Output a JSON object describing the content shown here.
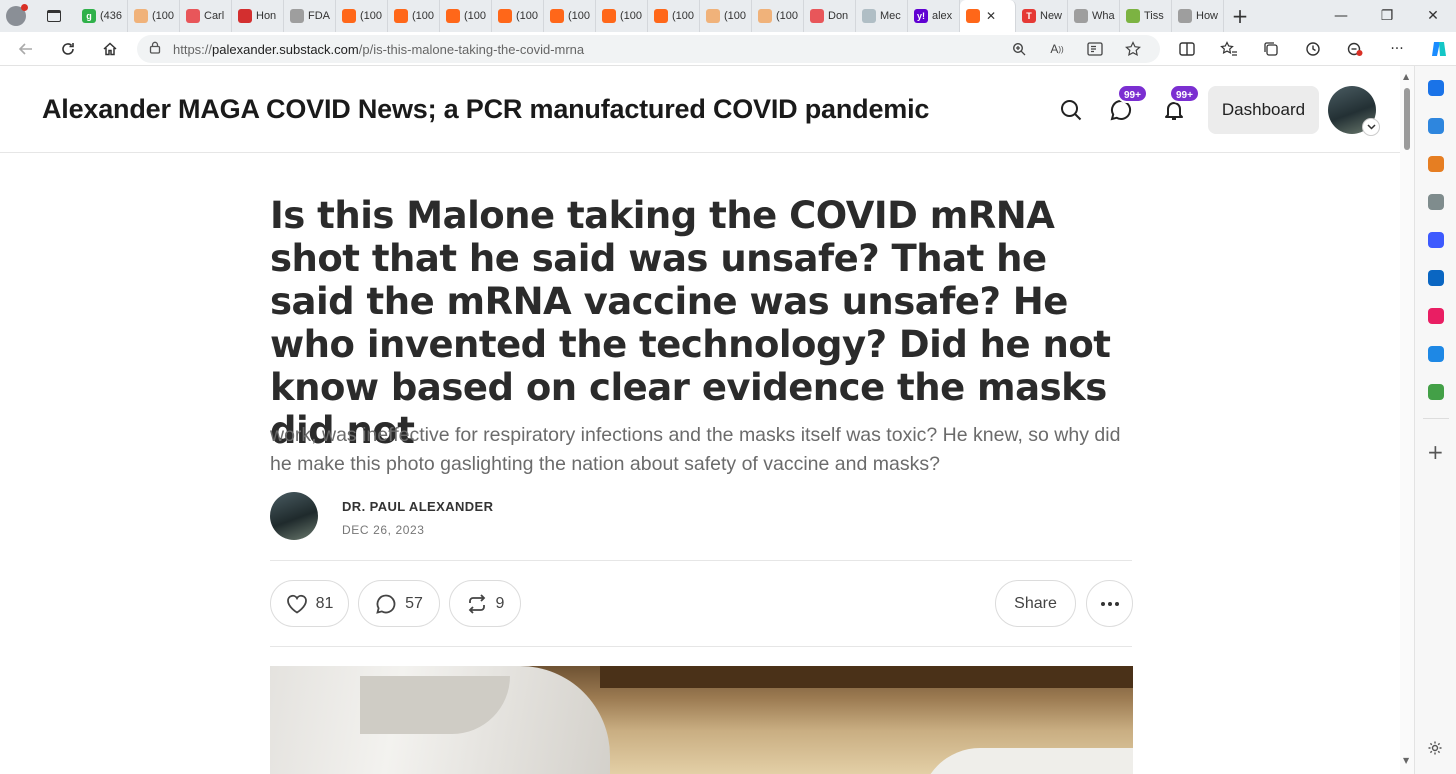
{
  "browser": {
    "tabs": [
      {
        "label": "(436",
        "favicon_color": "#2fb14a",
        "favicon_char": "g"
      },
      {
        "label": "(100",
        "favicon_color": "#f0b27a",
        "favicon_char": ""
      },
      {
        "label": "Carl",
        "favicon_color": "#e8565a",
        "favicon_char": ""
      },
      {
        "label": "Hon",
        "favicon_color": "#d32f2f",
        "favicon_char": ""
      },
      {
        "label": "FDA",
        "favicon_color": "#9e9e9e",
        "favicon_char": ""
      },
      {
        "label": "(100",
        "favicon_color": "#ff6719",
        "favicon_char": ""
      },
      {
        "label": "(100",
        "favicon_color": "#ff6719",
        "favicon_char": ""
      },
      {
        "label": "(100",
        "favicon_color": "#ff6719",
        "favicon_char": ""
      },
      {
        "label": "(100",
        "favicon_color": "#ff6719",
        "favicon_char": ""
      },
      {
        "label": "(100",
        "favicon_color": "#ff6719",
        "favicon_char": ""
      },
      {
        "label": "(100",
        "favicon_color": "#ff6719",
        "favicon_char": ""
      },
      {
        "label": "(100",
        "favicon_color": "#ff6719",
        "favicon_char": ""
      },
      {
        "label": "(100",
        "favicon_color": "#f0b27a",
        "favicon_char": ""
      },
      {
        "label": "(100",
        "favicon_color": "#f0b27a",
        "favicon_char": ""
      },
      {
        "label": "Don",
        "favicon_color": "#e8565a",
        "favicon_char": ""
      },
      {
        "label": "Mec",
        "favicon_color": "#b0bec5",
        "favicon_char": ""
      },
      {
        "label": "alex",
        "favicon_color": "#6001d2",
        "favicon_char": "y!"
      }
    ],
    "active_tab": {
      "favicon_color": "#ff6719",
      "close": "✕"
    },
    "tabs_after": [
      {
        "label": "New",
        "favicon_color": "#e53935",
        "favicon_char": "T"
      },
      {
        "label": "Wha",
        "favicon_color": "#9e9e9e",
        "favicon_char": ""
      },
      {
        "label": "Tiss",
        "favicon_color": "#7cb342",
        "favicon_char": ""
      },
      {
        "label": "How",
        "favicon_color": "#9e9e9e",
        "favicon_char": ""
      }
    ],
    "new_tab": "+",
    "window_controls": {
      "minimize": "—",
      "maximize": "❐",
      "close": "✕"
    },
    "url": {
      "scheme": "https://",
      "host": "palexander.substack.com",
      "path": "/p/is-this-malone-taking-the-covid-mrna"
    },
    "sidebar_colors": [
      "#1a73e8",
      "#2e86de",
      "#e67e22",
      "#7f8c8d",
      "#3d5afe",
      "#0a66c2",
      "#e91e63",
      "#1e88e5",
      "#43a047"
    ]
  },
  "header": {
    "publication_title": "Alexander MAGA COVID News; a PCR manufactured COVID pandemic",
    "chat_badge": "99+",
    "notif_badge": "99+",
    "dashboard_label": "Dashboard"
  },
  "post": {
    "title": "Is this Malone taking the COVID mRNA shot that he said was unsafe? That he said the mRNA vaccine was unsafe? He who invented the technology? Did he not know based on clear evidence the masks did not",
    "subtitle": "work, was ineffective for respiratory infections and the masks itself was toxic? He knew, so why did he make this photo gaslighting the nation about safety of vaccine and masks?",
    "author": "DR. PAUL ALEXANDER",
    "date": "DEC 26, 2023",
    "likes": "81",
    "comments": "57",
    "restacks": "9",
    "share_label": "Share"
  }
}
